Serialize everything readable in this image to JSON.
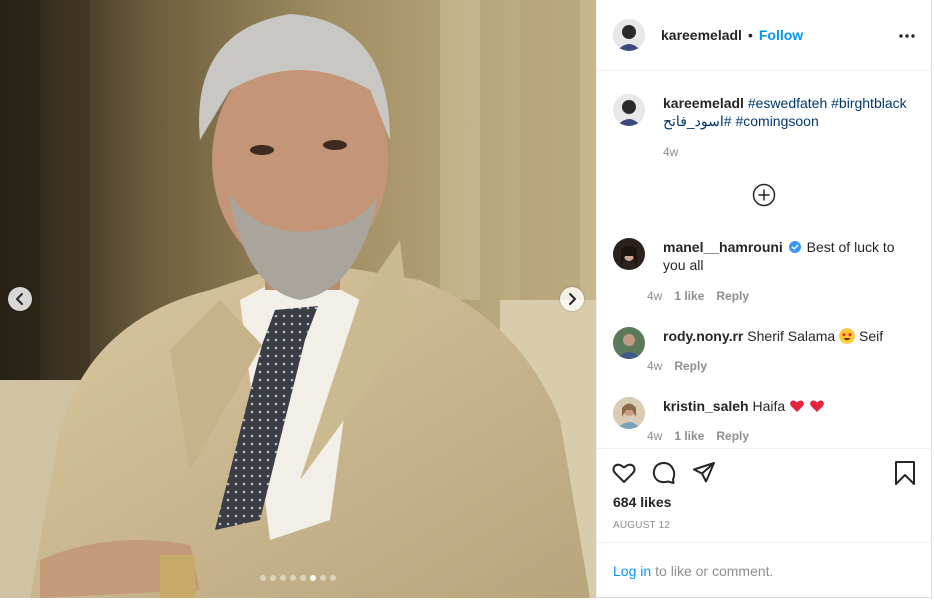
{
  "header": {
    "username": "kareemeladl",
    "separator": "•",
    "follow_label": "Follow"
  },
  "caption": {
    "username": "kareemeladl",
    "hashtags": [
      "#eswedfateh",
      "#birghtblack",
      "#اسود_فاتح",
      "#comingsoon"
    ],
    "time": "4w"
  },
  "comments": [
    {
      "username": "manel__hamrouni",
      "verified": true,
      "text": "Best of luck to you all",
      "time": "4w",
      "likes": "1 like",
      "reply_label": "Reply"
    },
    {
      "username": "rody.nony.rr",
      "text_before": "Sherif Salama",
      "emoji": "star-struck",
      "text_after": "Seif",
      "time": "4w",
      "reply_label": "Reply"
    },
    {
      "username": "kristin_saleh",
      "text": "Haifa",
      "emoji": "two-red-hearts",
      "time": "4w",
      "likes": "1 like",
      "reply_label": "Reply"
    }
  ],
  "actions": {
    "likes_count": "684 likes",
    "date": "AUGUST 12"
  },
  "login": {
    "link_label": "Log in",
    "rest": "to like or comment."
  },
  "carousel": {
    "slide_count": 8,
    "active_index": 5
  },
  "colors": {
    "link_blue": "#0095f6",
    "hashtag_blue": "#00376b",
    "muted_gray": "#8e8e8e",
    "heart_red": "#ed4956"
  }
}
